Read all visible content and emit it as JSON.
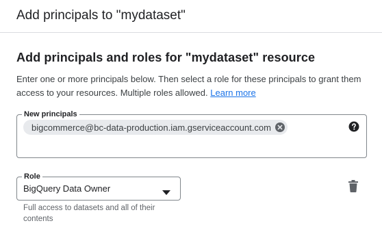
{
  "header": {
    "title": "Add principals to \"mydataset\""
  },
  "section": {
    "title": "Add principals and roles for \"mydataset\" resource",
    "description": "Enter one or more principals below. Then select a role for these principals to grant them access to your resources. Multiple roles allowed.",
    "learn_more": "Learn more"
  },
  "principals": {
    "label": "New principals",
    "chips": [
      {
        "value": "bigcommerce@bc-data-production.iam.gserviceaccount.com"
      }
    ],
    "help_icon": "help-circle-icon"
  },
  "role": {
    "label": "Role",
    "selected": "BigQuery Data Owner",
    "help_text": "Full access to datasets and all of their contents",
    "dropdown_icon": "arrow-drop-down-icon",
    "delete_icon": "trash-icon"
  },
  "colors": {
    "link": "#1a73e8",
    "chip_bg": "#e8eaed",
    "border": "#80868b"
  }
}
